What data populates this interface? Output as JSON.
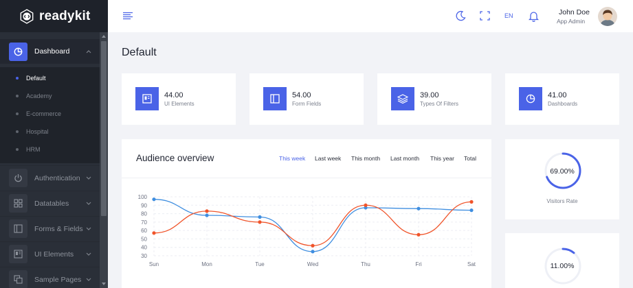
{
  "brand": {
    "name": "readykit"
  },
  "sidebar": {
    "active": {
      "label": "Dashboard"
    },
    "submenu": [
      "Default",
      "Academy",
      "E-commerce",
      "Hospital",
      "HRM"
    ],
    "items": [
      {
        "label": "Authentication"
      },
      {
        "label": "Datatables"
      },
      {
        "label": "Forms & Fields"
      },
      {
        "label": "UI Elements"
      },
      {
        "label": "Sample Pages"
      }
    ]
  },
  "header": {
    "lang": "EN",
    "user_name": "John Doe",
    "user_role": "App Admin"
  },
  "page": {
    "title": "Default"
  },
  "stats": [
    {
      "value": "44.00",
      "label": "UI Elements"
    },
    {
      "value": "54.00",
      "label": "Form Fields"
    },
    {
      "value": "39.00",
      "label": "Types Of Filters"
    },
    {
      "value": "41.00",
      "label": "Dashboards"
    }
  ],
  "audience": {
    "title": "Audience overview",
    "tabs": [
      "This week",
      "Last week",
      "This month",
      "Last month",
      "This year",
      "Total"
    ],
    "active_tab": "This week"
  },
  "rings": [
    {
      "value": "69.00%",
      "label": "Visitors Rate",
      "fraction": 0.69
    },
    {
      "value": "11.00%",
      "fraction": 0.11
    }
  ],
  "colors": {
    "accent": "#4a63e7",
    "series_blue": "#3f8ee0",
    "series_orange": "#f0542a"
  },
  "chart_data": {
    "type": "line",
    "categories": [
      "Sun",
      "Mon",
      "Tue",
      "Wed",
      "Thu",
      "Fri",
      "Sat"
    ],
    "y_ticks": [
      100,
      90,
      80,
      70,
      60,
      50,
      40,
      30
    ],
    "ylim": [
      30,
      100
    ],
    "series": [
      {
        "values": [
          97,
          78,
          76,
          35,
          87,
          86,
          84
        ]
      },
      {
        "values": [
          57,
          83,
          70,
          42,
          90,
          55,
          94
        ]
      }
    ]
  }
}
